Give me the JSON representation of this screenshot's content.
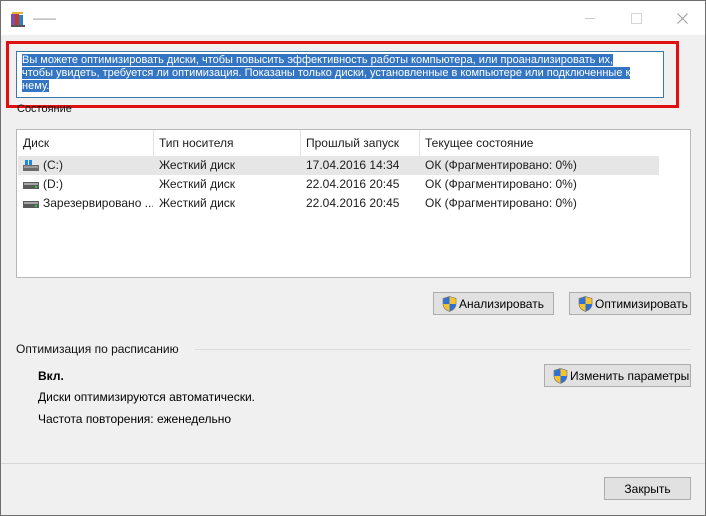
{
  "window": {
    "title": "——",
    "controls": [
      "minimize",
      "maximize",
      "close"
    ]
  },
  "description": {
    "line1": "Вы можете оптимизировать диски, чтобы повысить эффективность работы  компьютера, или проанализировать их,",
    "line2": "чтобы увидеть, требуется ли оптимизация. Показаны только диски, установленные в компьютере или подключенные к",
    "line3": "нему."
  },
  "status": {
    "label": "Состояние",
    "columns": [
      "Диск",
      "Тип носителя",
      "Прошлый запуск",
      "Текущее состояние"
    ],
    "rows": [
      {
        "disk": "(C:)",
        "type": "Жесткий диск",
        "last_run": "17.04.2016 14:34",
        "state": "ОК (Фрагментировано: 0%)",
        "icon": "windows-drive-icon"
      },
      {
        "disk": "(D:)",
        "type": "Жесткий диск",
        "last_run": "22.04.2016 20:45",
        "state": "ОК (Фрагментировано: 0%)",
        "icon": "hard-drive-icon"
      },
      {
        "disk": "Зарезервировано ...",
        "type": "Жесткий диск",
        "last_run": "22.04.2016 20:45",
        "state": "ОК (Фрагментировано: 0%)",
        "icon": "hard-drive-icon"
      }
    ]
  },
  "buttons": {
    "analyze": "Анализировать",
    "optimize": "Оптимизировать",
    "change_settings": "Изменить параметры",
    "close": "Закрыть"
  },
  "schedule": {
    "label": "Оптимизация по расписанию",
    "state": "Вкл.",
    "description": "Диски оптимизируются автоматически.",
    "frequency": "Частота повторения: еженедельно"
  },
  "colors": {
    "selection": "#3375c2",
    "highlight_frame": "#e01010",
    "row_selected": "#e6e6e6"
  }
}
